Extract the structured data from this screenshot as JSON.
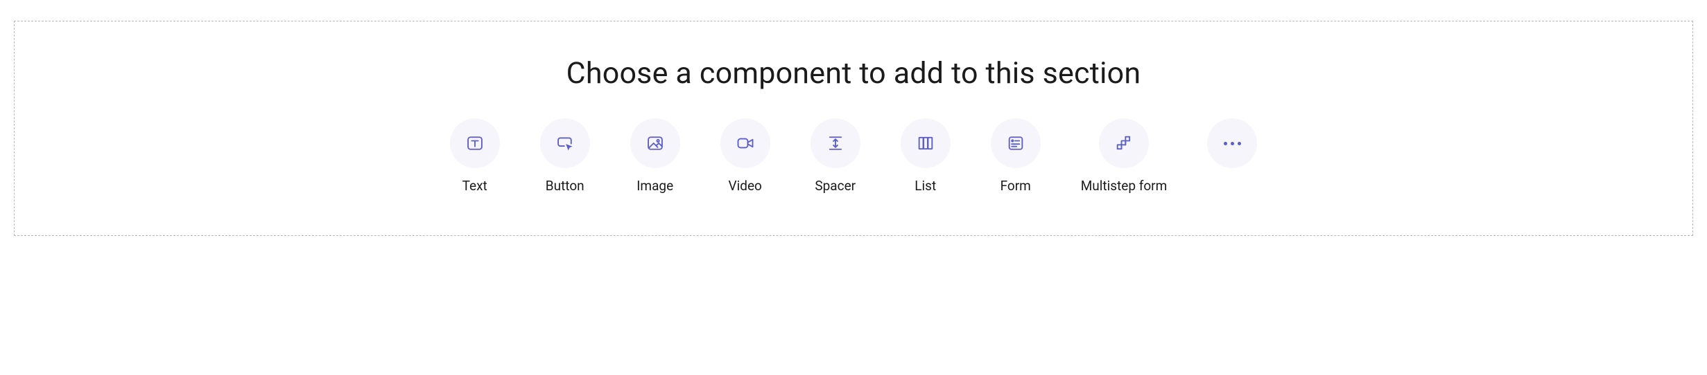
{
  "section": {
    "title": "Choose a component to add to this section",
    "components": [
      {
        "id": "text",
        "label": "Text",
        "icon": "text-icon"
      },
      {
        "id": "button",
        "label": "Button",
        "icon": "button-icon"
      },
      {
        "id": "image",
        "label": "Image",
        "icon": "image-icon"
      },
      {
        "id": "video",
        "label": "Video",
        "icon": "video-icon"
      },
      {
        "id": "spacer",
        "label": "Spacer",
        "icon": "spacer-icon"
      },
      {
        "id": "list",
        "label": "List",
        "icon": "list-icon"
      },
      {
        "id": "form",
        "label": "Form",
        "icon": "form-icon"
      },
      {
        "id": "multistep-form",
        "label": "Multistep form",
        "icon": "multistep-form-icon"
      },
      {
        "id": "more",
        "label": "",
        "icon": "more-icon"
      }
    ]
  },
  "colors": {
    "accent": "#5b5fc7",
    "icon_bg": "#f6f5fb",
    "border": "#b8b8b8",
    "text": "#1b1b1b"
  }
}
